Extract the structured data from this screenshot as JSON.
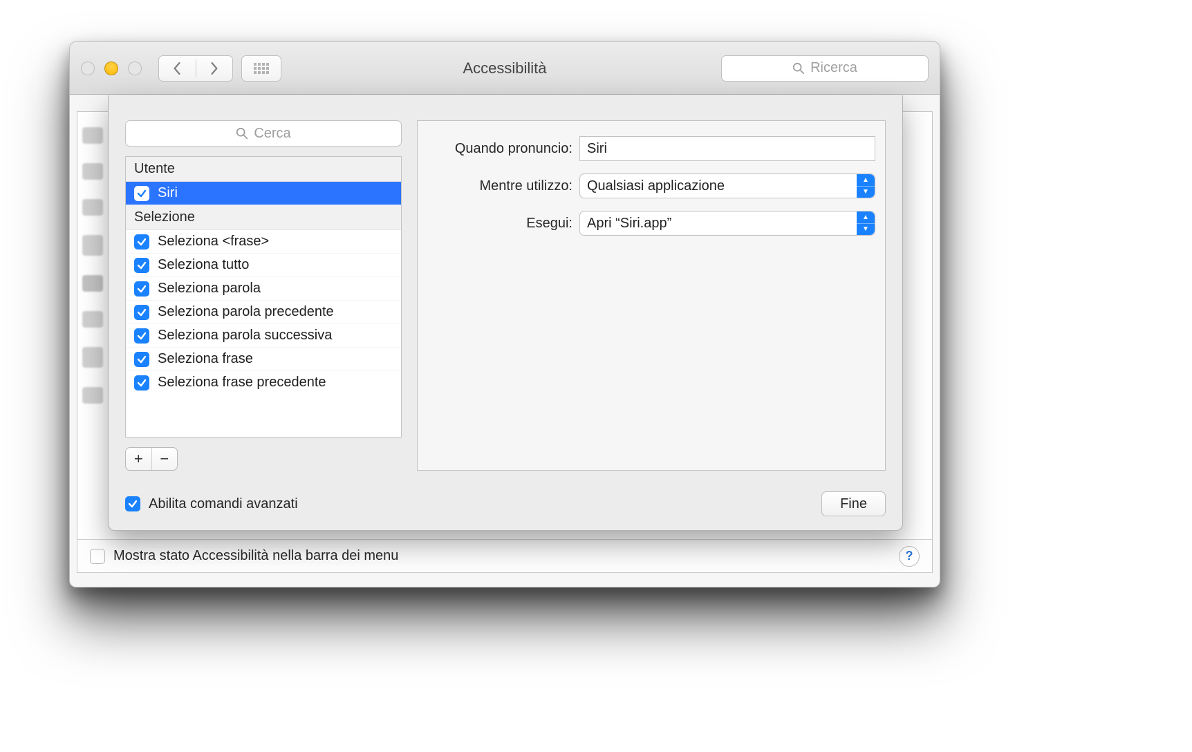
{
  "window": {
    "title": "Accessibilità",
    "search_placeholder": "Ricerca"
  },
  "back_window": {
    "menubar_checkbox_label": "Mostra stato Accessibilità nella barra dei menu"
  },
  "sheet": {
    "local_search_placeholder": "Cerca",
    "sections": {
      "utente": {
        "title": "Utente",
        "items": [
          {
            "label": "Siri",
            "checked": true,
            "selected": true
          }
        ]
      },
      "selezione": {
        "title": "Selezione",
        "items": [
          {
            "label": "Seleziona <frase>",
            "checked": true
          },
          {
            "label": "Seleziona tutto",
            "checked": true
          },
          {
            "label": "Seleziona parola",
            "checked": true
          },
          {
            "label": "Seleziona parola precedente",
            "checked": true
          },
          {
            "label": "Seleziona parola successiva",
            "checked": true
          },
          {
            "label": "Seleziona frase",
            "checked": true
          },
          {
            "label": "Seleziona frase precedente",
            "checked": true
          }
        ]
      }
    },
    "add": "+",
    "remove": "−",
    "form": {
      "when_label": "Quando pronuncio:",
      "when_value": "Siri",
      "while_label": "Mentre utilizzo:",
      "while_value": "Qualsiasi applicazione",
      "execute_label": "Esegui:",
      "execute_value": "Apri “Siri.app”"
    },
    "advanced_checkbox_label": "Abilita comandi avanzati",
    "done_button": "Fine"
  }
}
